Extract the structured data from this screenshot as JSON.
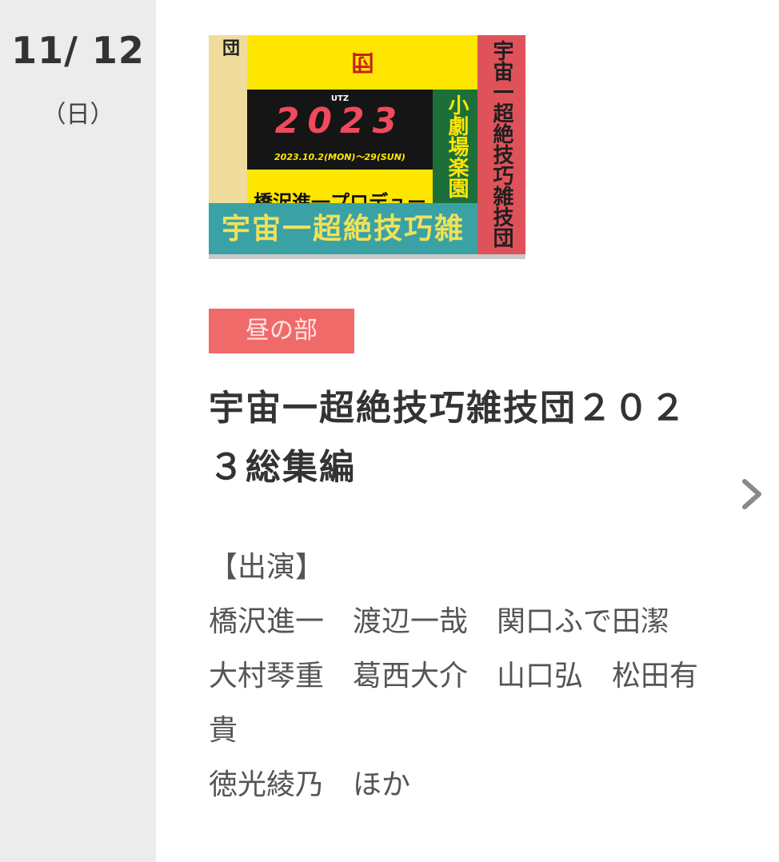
{
  "date": {
    "main": "11/ 12",
    "weekday": "（日）"
  },
  "poster": {
    "top": "宇宙一超絶技巧雑技団",
    "left": "宇宙一超絶技巧雑技団",
    "right": "宇宙一超絶技巧雑技団",
    "center_utz": "UTZ",
    "center_year": "2023",
    "center_dates": "2023.10.2(MON)〜29(SUN)",
    "green": "小劇場楽園",
    "produce": "橋沢進一プロデュース",
    "bottom": "宇宙一超絶技巧雑技団"
  },
  "event": {
    "badge": "昼の部",
    "title": "宇宙一超絶技巧雑技団２０２３総集編",
    "cast_heading": "【出演】",
    "cast_lines": [
      "橋沢進一　渡辺一哉　関口ふで田潔",
      "大村琴重　葛西大介　山口弘　松田有貴",
      "徳光綾乃　ほか"
    ]
  },
  "colors": {
    "badge": "#f06a6a",
    "sidebar": "#ececec",
    "chevron": "#8a8a8a"
  },
  "icons": {
    "chevron": "chevron-right-icon"
  }
}
